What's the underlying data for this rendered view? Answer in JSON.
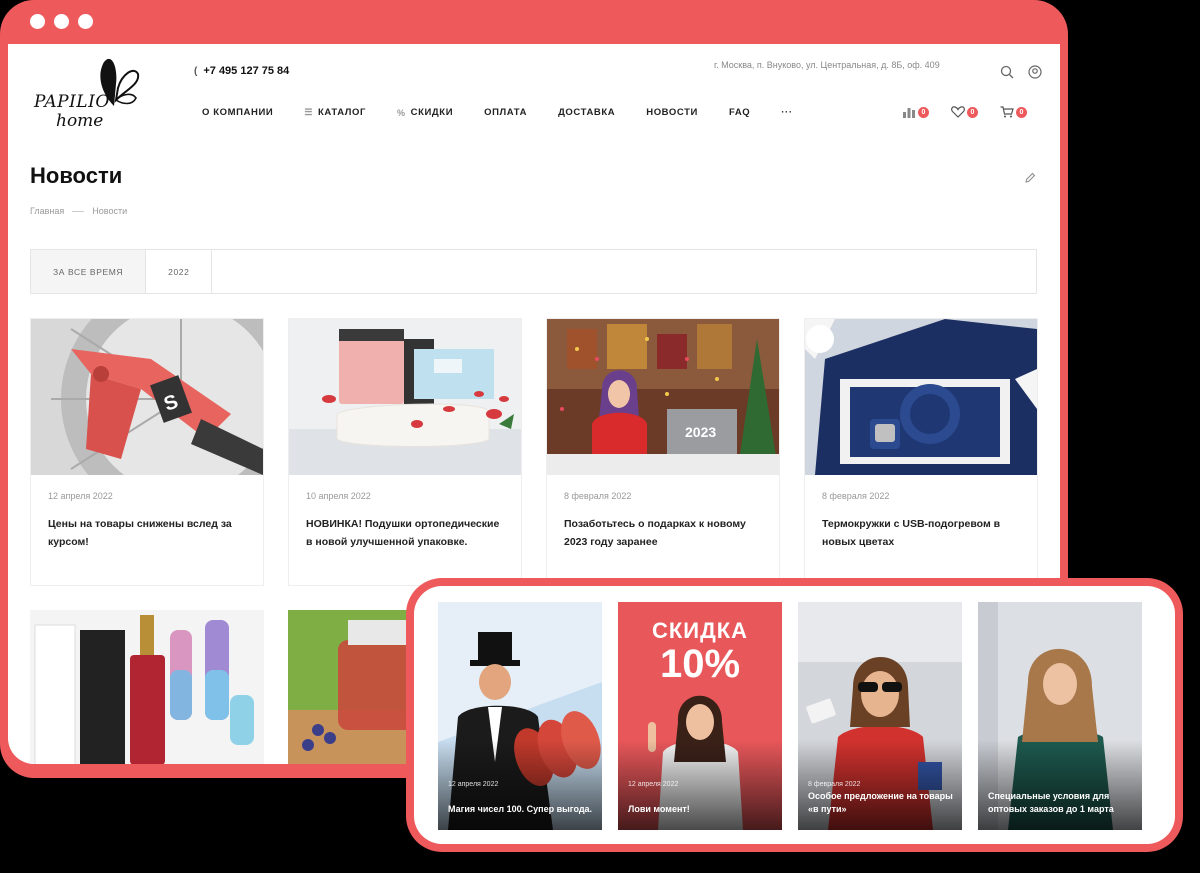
{
  "header": {
    "logo_line1": "PAPILIO",
    "logo_line2": "home",
    "phone": "+7 495 127 75 84",
    "address": "г. Москва, п. Внуково, ул. Центральная, д. 8Б, оф. 409",
    "nav": [
      {
        "label": "О КОМПАНИИ",
        "icon": "dot"
      },
      {
        "label": "КАТАЛОГ",
        "icon": "menu-icon"
      },
      {
        "label": "СКИДКИ",
        "icon": "percent-icon"
      },
      {
        "label": "ОПЛАТА"
      },
      {
        "label": "ДОСТАВКА"
      },
      {
        "label": "НОВОСТИ"
      },
      {
        "label": "FAQ"
      },
      {
        "label": "···"
      }
    ],
    "counters": {
      "compare": "0",
      "favorites": "0",
      "cart": "0"
    }
  },
  "page": {
    "title": "Новости",
    "breadcrumb": [
      "Главная",
      "Новости"
    ],
    "filters": [
      "ЗА ВСЕ ВРЕМЯ",
      "2022"
    ]
  },
  "news": [
    {
      "date": "12 апреля 2022",
      "title": "Цены на товары снижены вслед за курсом!"
    },
    {
      "date": "10 апреля 2022",
      "title": "НОВИНКА! Подушки ортопедические в новой улучшенной упаковке."
    },
    {
      "date": "8 февраля 2022",
      "title": "Позаботьтесь о подарках к новому 2023 году заранее"
    },
    {
      "date": "8 февраля 2022",
      "title": "Термокружки с USB-подогревом в новых цветах"
    }
  ],
  "stories": [
    {
      "date": "12 апреля 2022",
      "title": "Магия чисел 100. Супер выгода."
    },
    {
      "date": "12 апреля 2022",
      "title": "Лови момент!",
      "banner_line1": "СКИДКА",
      "banner_line2": "10%"
    },
    {
      "date": "8 февраля 2022",
      "title": "Особое предложение на товары «в пути»"
    },
    {
      "date": "",
      "title": "Специальные условия для оптовых заказов до 1 марта"
    }
  ],
  "colors": {
    "accent": "#ee5a5c"
  }
}
